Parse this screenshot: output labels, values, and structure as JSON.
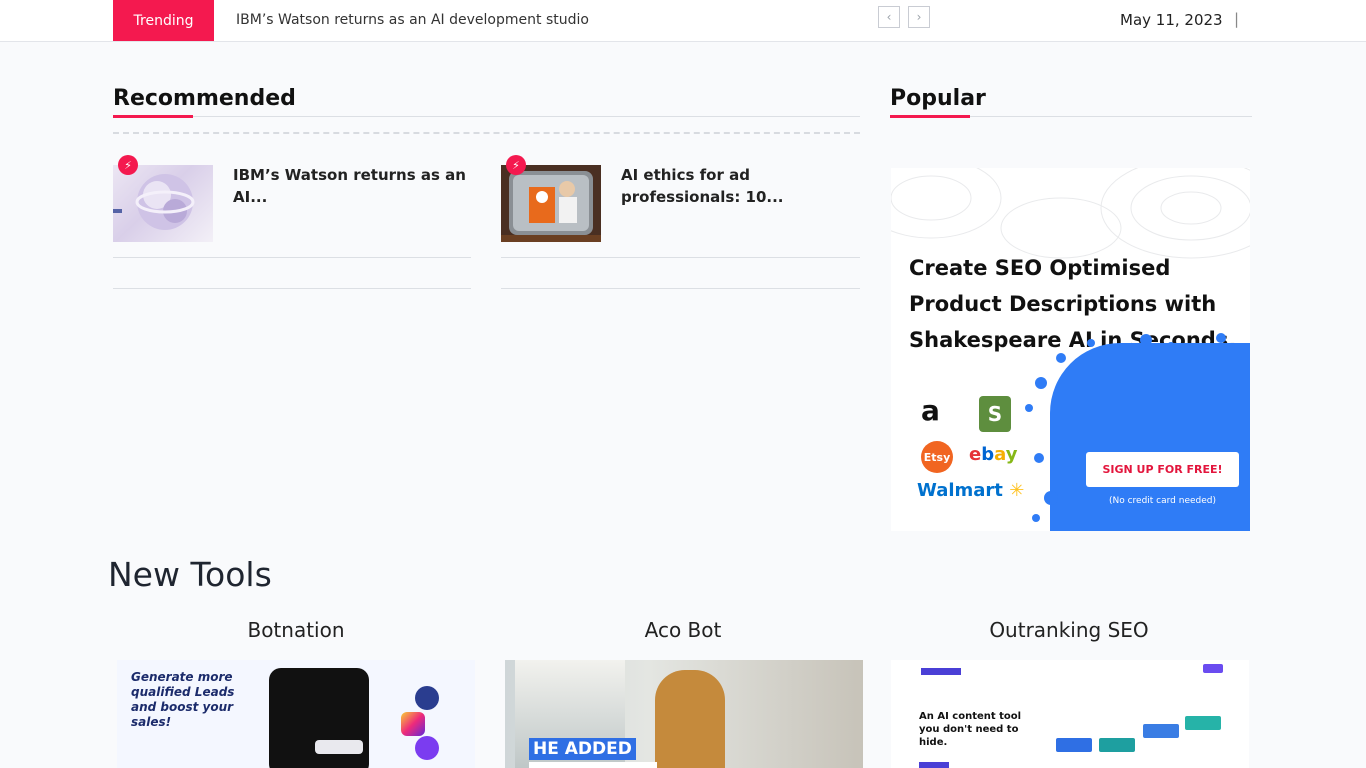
{
  "topbar": {
    "trending_label": "Trending",
    "headline": "IBM’s Watson returns as an AI development studio",
    "prev_icon": "chevron-left-icon",
    "next_icon": "chevron-right-icon",
    "prev_glyph": "‹",
    "next_glyph": "›",
    "date": "May 11, 2023",
    "separator": "|"
  },
  "recommended": {
    "title": "Recommended",
    "items": [
      {
        "title": "IBM’s Watson returns as an AI...",
        "icon": "bolt-icon"
      },
      {
        "title": "AI ethics for ad professionals: 10...",
        "icon": "bolt-icon"
      }
    ]
  },
  "popular": {
    "title": "Popular",
    "ad": {
      "headline_line": "Create SEO Optimised Product Descriptions with Shakespeare AI in ",
      "headline_emph": "Seconds.",
      "button": "SIGN UP FOR FREE!",
      "note": "(No credit card needed)",
      "logos": {
        "amazon": "a",
        "shopify": "S",
        "etsy": "Etsy",
        "ebay": "ebay",
        "walmart": "Walmart"
      },
      "colors": {
        "blue": "#2f7cf6",
        "cta_text": "#e3163d"
      }
    }
  },
  "new_tools": {
    "title": "New Tools",
    "tools": [
      {
        "name": "Botnation",
        "image_caption": "Generate more qualified Leads and boost your sales!"
      },
      {
        "name": "Aco Bot",
        "image_caption": "HE ADDED"
      },
      {
        "name": "Outranking SEO",
        "image_caption": "An AI content tool you don't need to hide."
      }
    ]
  },
  "colors": {
    "accent": "#f4194f",
    "background": "#f9fafc"
  }
}
